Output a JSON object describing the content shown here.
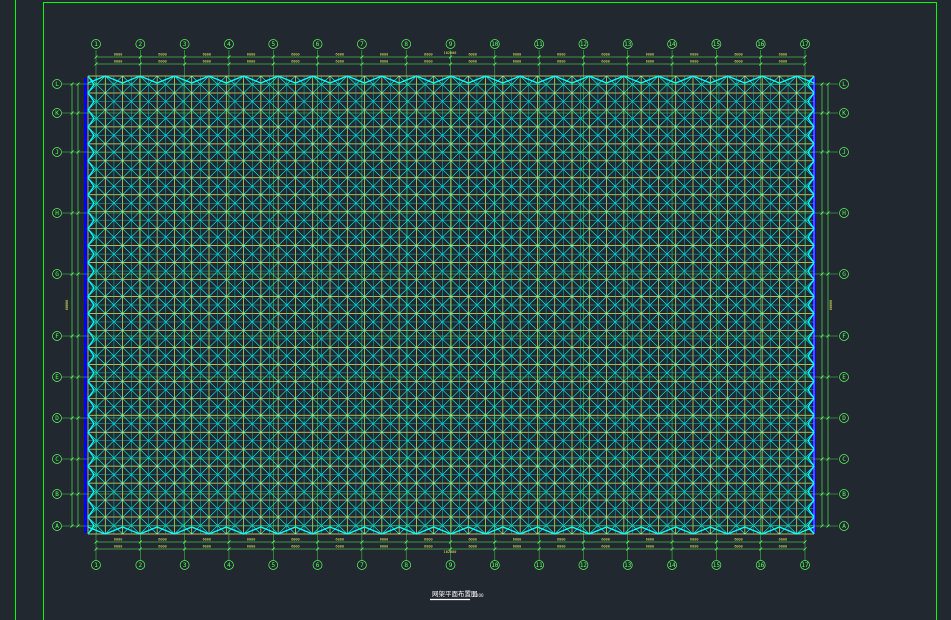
{
  "drawing": {
    "title": "网架平面布置图",
    "scale": "1:200",
    "top_total_dim": "102000",
    "bottom_total_dim": "102000",
    "left_total_dim": "60000",
    "right_total_dim": "60000",
    "module_dim": "6000"
  },
  "column_axes": [
    "1",
    "2",
    "3",
    "4",
    "5",
    "6",
    "7",
    "8",
    "9",
    "10",
    "11",
    "12",
    "13",
    "14",
    "15",
    "16",
    "17"
  ],
  "row_axes": [
    "L",
    "K",
    "J",
    "H",
    "G",
    "F",
    "E",
    "D",
    "C",
    "B",
    "A"
  ],
  "colors": {
    "background": "#212830",
    "frame": "#00ff00",
    "axis": "#5dff5d",
    "upper_chord": "#e8e860",
    "web_member": "#00ffff",
    "lower_chord": "#00c8c8",
    "support_edge": "#0000ff",
    "title": "#ffffff"
  }
}
